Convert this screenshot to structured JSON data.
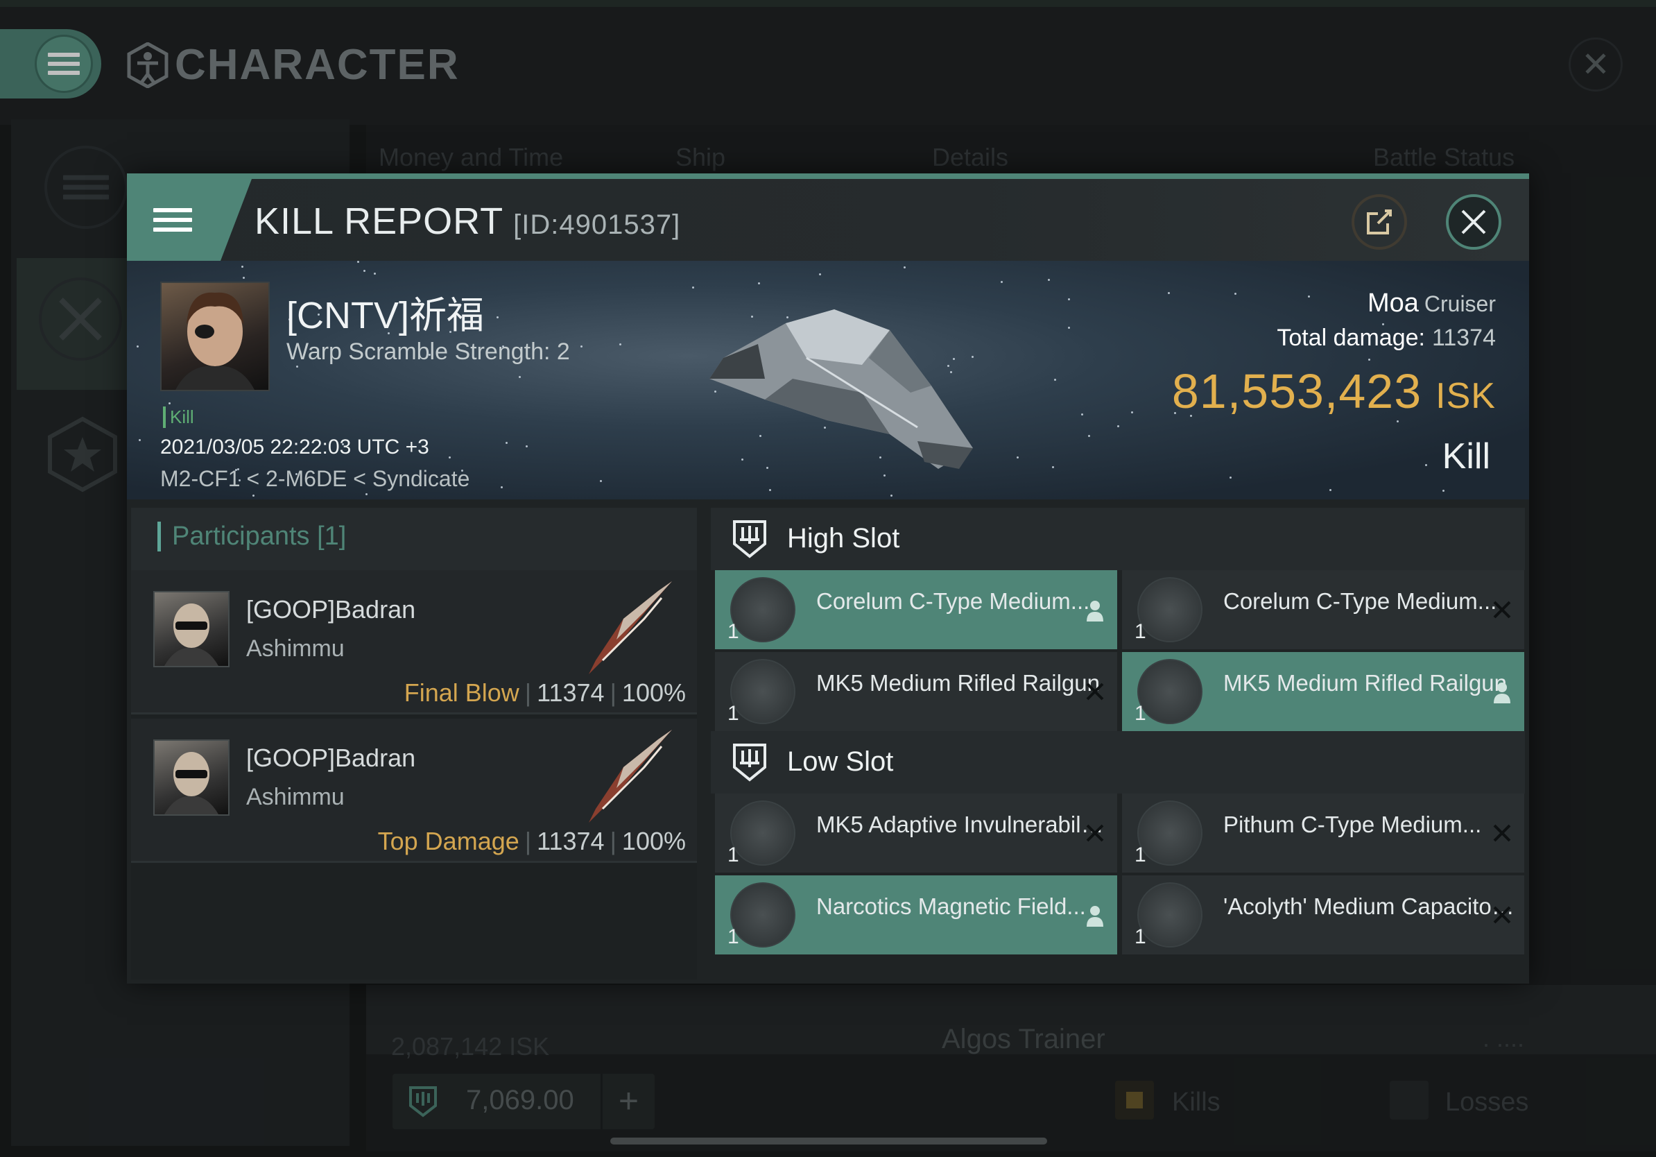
{
  "base": {
    "title": "CHARACTER",
    "close": "✕",
    "tabs": [
      "Money and Time",
      "Ship",
      "Details",
      "Battle Status"
    ],
    "row_isk": "2,087,142 ISK",
    "row_ship": "Algos Trainer",
    "row_more": ". ....",
    "wallet": "7,069.00",
    "add": "+",
    "filter_kills": "Kills",
    "filter_losses": "Losses"
  },
  "report": {
    "title": "KILL REPORT",
    "id": "[ID:4901537]",
    "victim": {
      "name": "[CNTV]祈福",
      "sub": "Warp Scramble Strength: 2",
      "badge": "Kill",
      "datetime": "2021/03/05 22:22:03 UTC +3",
      "location": "M2-CF1 < 2-M6DE < Syndicate"
    },
    "ship_name": "Moa",
    "ship_class": "Cruiser",
    "damage_label": "Total damage:",
    "damage_value": "11374",
    "isk_value": "81,553,423",
    "isk_unit": "ISK",
    "outcome": "Kill"
  },
  "participants": {
    "title": "Participants [1]",
    "rows": [
      {
        "name": "[GOOP]Badran",
        "ship": "Ashimmu",
        "tag": "Final Blow",
        "damage": "11374",
        "percent": "100%"
      },
      {
        "name": "[GOOP]Badran",
        "ship": "Ashimmu",
        "tag": "Top Damage",
        "damage": "11374",
        "percent": "100%"
      }
    ]
  },
  "fittings": {
    "high_label": "High Slot",
    "low_label": "Low Slot",
    "high": [
      {
        "name": "Corelum C-Type Medium...",
        "qty": "1",
        "status": "dropped"
      },
      {
        "name": "Corelum C-Type Medium...",
        "qty": "1",
        "status": "destroyed"
      },
      {
        "name": "MK5 Medium Rifled Railgun",
        "qty": "1",
        "status": "destroyed"
      },
      {
        "name": "MK5 Medium Rifled Railgun",
        "qty": "1",
        "status": "dropped"
      }
    ],
    "low": [
      {
        "name": "MK5 Adaptive Invulnerabilit...",
        "qty": "1",
        "status": "destroyed"
      },
      {
        "name": "Pithum C-Type Medium...",
        "qty": "1",
        "status": "destroyed"
      },
      {
        "name": "Narcotics Magnetic Field...",
        "qty": "1",
        "status": "dropped"
      },
      {
        "name": "'Acolyth' Medium Capacitor ...",
        "qty": "1",
        "status": "destroyed"
      }
    ]
  }
}
